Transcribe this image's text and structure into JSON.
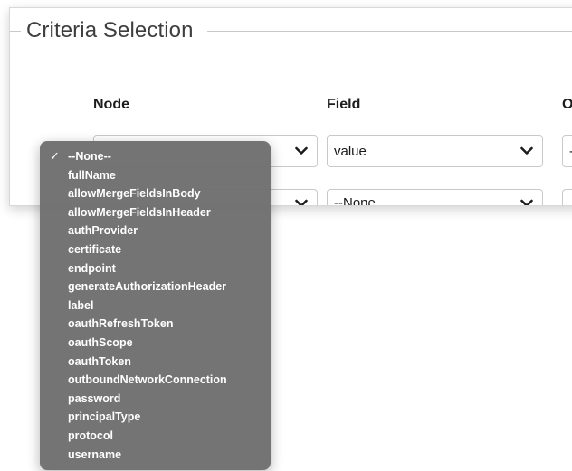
{
  "panel": {
    "title": "Criteria Selection"
  },
  "columns": {
    "node": "Node",
    "field": "Field",
    "operator_partial": "O"
  },
  "field_select": {
    "value": "value"
  },
  "second_row": {
    "field_value": "--None"
  },
  "operator_select": {
    "value_partial": "-"
  },
  "dropdown": {
    "selected_index": 0,
    "items": [
      "--None--",
      "fullName",
      "allowMergeFieldsInBody",
      "allowMergeFieldsInHeader",
      "authProvider",
      "certificate",
      "endpoint",
      "generateAuthorizationHeader",
      "label",
      "oauthRefreshToken",
      "oauthScope",
      "oauthToken",
      "outboundNetworkConnection",
      "password",
      "principalType",
      "protocol",
      "username"
    ]
  },
  "colors": {
    "dropdown_bg": "#6e6e6e",
    "text_dark": "#181818",
    "border": "#c9c9c9"
  }
}
